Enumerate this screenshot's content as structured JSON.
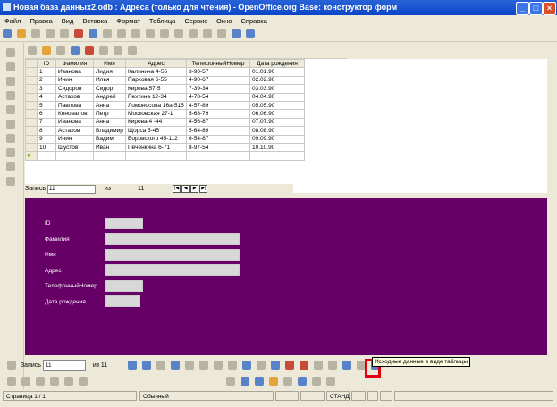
{
  "title": "Новая база данных2.odb : Адреса (только для чтения) - OpenOffice.org Base: конструктор форм",
  "menu": [
    "Файл",
    "Правка",
    "Вид",
    "Вставка",
    "Формат",
    "Таблица",
    "Сервис",
    "Окно",
    "Справка"
  ],
  "grid": {
    "columns": [
      "ID",
      "Фамилия",
      "Имя",
      "Адрес",
      "ТелефонныйНомер",
      "Дата рождения"
    ],
    "rows": [
      [
        "1",
        "Иванова",
        "Лидия",
        "Калинина 4-56",
        "3-90-57",
        "01.01.90"
      ],
      [
        "2",
        "Инин",
        "Илья",
        "Парковая 6-55",
        "4-90-67",
        "02.02.90"
      ],
      [
        "3",
        "Сидоров",
        "Сидор",
        "Кирова 57-5",
        "7-39-34",
        "03.03.90"
      ],
      [
        "4",
        "Астахов",
        "Андрей",
        "Пехтина 12-34",
        "4-78-54",
        "04.04.90"
      ],
      [
        "5",
        "Павлова",
        "Анна",
        "Ломоносова 16а-515",
        "4-57-89",
        "05.05.90"
      ],
      [
        "6",
        "Коновалов",
        "Петр",
        "Московская 27-1",
        "5-68-79",
        "06.06.90"
      ],
      [
        "7",
        "Иванова",
        "Анна",
        "Кирова 4 -44",
        "4-56-87",
        "07.07.90"
      ],
      [
        "8",
        "Астахов",
        "Владимир",
        "Щорса 5-45",
        "5-64-89",
        "08.08.90"
      ],
      [
        "9",
        "Инин",
        "Вадим",
        "Воровского 45-112",
        "6-54-87",
        "09.09.90"
      ],
      [
        "10",
        "Шустов",
        "Иван",
        "Печенкина 6-71",
        "8-97-54",
        "10.10.90"
      ]
    ],
    "record_label": "Запись",
    "record_value": "11",
    "of_label": "из",
    "of_value": "11"
  },
  "form": {
    "labels": [
      "ID",
      "Фамилия",
      "Имя",
      "Адрес",
      "ТелефонныйНомер",
      "Дата рождения"
    ]
  },
  "navbar": {
    "record_label": "Запись",
    "record_value": "11",
    "of_label": "из 11"
  },
  "tooltip": "Исходные данные в виде таблицы",
  "status": {
    "page": "Страница 1 / 1",
    "style": "Обычный",
    "mode": "СТАНД"
  }
}
